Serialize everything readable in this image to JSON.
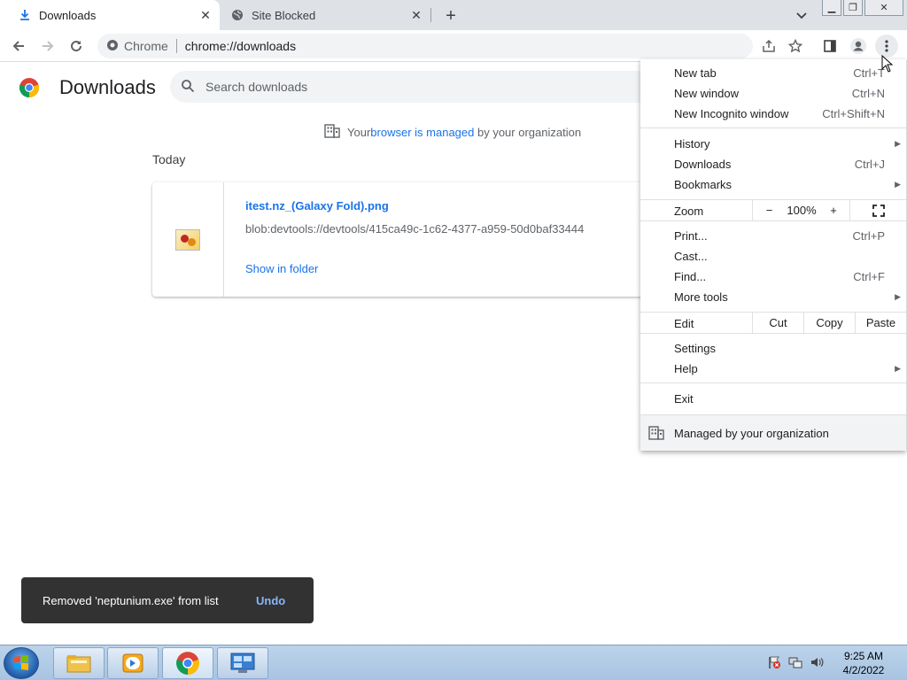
{
  "tabs": [
    {
      "title": "Downloads",
      "icon": "download-icon",
      "active": true
    },
    {
      "title": "Site Blocked",
      "icon": "globe-icon",
      "active": false
    }
  ],
  "toolbar": {
    "site_label": "Chrome",
    "url": "chrome://downloads"
  },
  "downloads": {
    "title": "Downloads",
    "search_placeholder": "Search downloads",
    "managed_prefix": "Your ",
    "managed_link1": "browser",
    "managed_mid": " is ",
    "managed_link2": "managed",
    "managed_suffix": " by your organization",
    "section": "Today",
    "item": {
      "name": "itest.nz_(Galaxy Fold).png",
      "url": "blob:devtools://devtools/415ca49c-1c62-4377-a959-50d0baf33444",
      "action": "Show in folder"
    }
  },
  "snackbar": {
    "message": "Removed 'neptunium.exe' from list",
    "action": "Undo"
  },
  "menu": {
    "new_tab": {
      "label": "New tab",
      "shortcut": "Ctrl+T"
    },
    "new_window": {
      "label": "New window",
      "shortcut": "Ctrl+N"
    },
    "incognito": {
      "label": "New Incognito window",
      "shortcut": "Ctrl+Shift+N"
    },
    "history": {
      "label": "History"
    },
    "downloads": {
      "label": "Downloads",
      "shortcut": "Ctrl+J"
    },
    "bookmarks": {
      "label": "Bookmarks"
    },
    "zoom": {
      "label": "Zoom",
      "minus": "−",
      "level": "100%",
      "plus": "+"
    },
    "print": {
      "label": "Print...",
      "shortcut": "Ctrl+P"
    },
    "cast": {
      "label": "Cast..."
    },
    "find": {
      "label": "Find...",
      "shortcut": "Ctrl+F"
    },
    "more_tools": {
      "label": "More tools"
    },
    "edit": {
      "label": "Edit",
      "cut": "Cut",
      "copy": "Copy",
      "paste": "Paste"
    },
    "settings": {
      "label": "Settings"
    },
    "help": {
      "label": "Help"
    },
    "exit": {
      "label": "Exit"
    },
    "managed": {
      "label": "Managed by your organization"
    }
  },
  "taskbar": {
    "time": "9:25 AM",
    "date": "4/2/2022"
  },
  "colors": {
    "accent": "#1a73e8",
    "tabstrip": "#dee1e6",
    "snackbar": "#323232"
  }
}
